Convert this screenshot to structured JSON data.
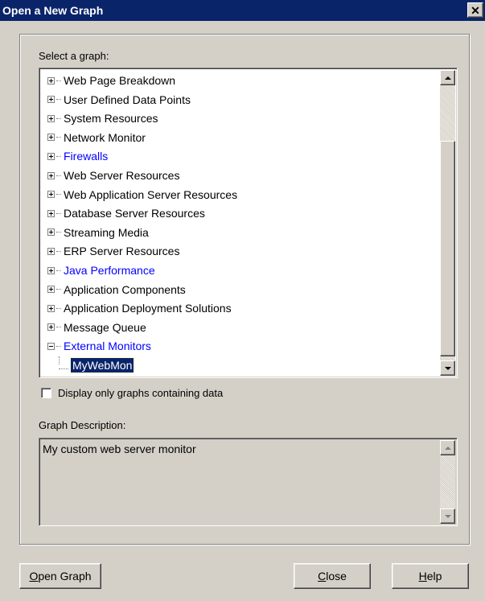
{
  "window": {
    "title": "Open a New Graph",
    "close_glyph": "✕"
  },
  "select_label": "Select a graph:",
  "tree": {
    "items": [
      {
        "label": "Web Page Breakdown",
        "color": "#000000",
        "expanded": false
      },
      {
        "label": "User Defined Data Points",
        "color": "#000000",
        "expanded": false
      },
      {
        "label": "System Resources",
        "color": "#000000",
        "expanded": false
      },
      {
        "label": "Network Monitor",
        "color": "#000000",
        "expanded": false
      },
      {
        "label": "Firewalls",
        "color": "#0000ff",
        "expanded": false
      },
      {
        "label": "Web Server Resources",
        "color": "#000000",
        "expanded": false
      },
      {
        "label": "Web Application Server Resources",
        "color": "#000000",
        "expanded": false
      },
      {
        "label": "Database Server Resources",
        "color": "#000000",
        "expanded": false
      },
      {
        "label": "Streaming Media",
        "color": "#000000",
        "expanded": false
      },
      {
        "label": "ERP Server Resources",
        "color": "#000000",
        "expanded": false
      },
      {
        "label": "Java Performance",
        "color": "#0000ff",
        "expanded": false
      },
      {
        "label": "Application Components",
        "color": "#000000",
        "expanded": false
      },
      {
        "label": "Application Deployment Solutions",
        "color": "#000000",
        "expanded": false
      },
      {
        "label": "Message Queue",
        "color": "#000000",
        "expanded": false
      },
      {
        "label": "External Monitors",
        "color": "#0000ff",
        "expanded": true
      }
    ],
    "child": {
      "label": "MyWebMon",
      "selected": true
    }
  },
  "checkbox": {
    "label": "Display only graphs containing data",
    "checked": false
  },
  "description": {
    "label": "Graph Description:",
    "text": "My custom web server monitor"
  },
  "buttons": {
    "open_graph": {
      "accel": "O",
      "rest": "pen Graph"
    },
    "close": {
      "accel": "C",
      "rest": "lose"
    },
    "help": {
      "accel": "H",
      "rest": "elp"
    }
  }
}
